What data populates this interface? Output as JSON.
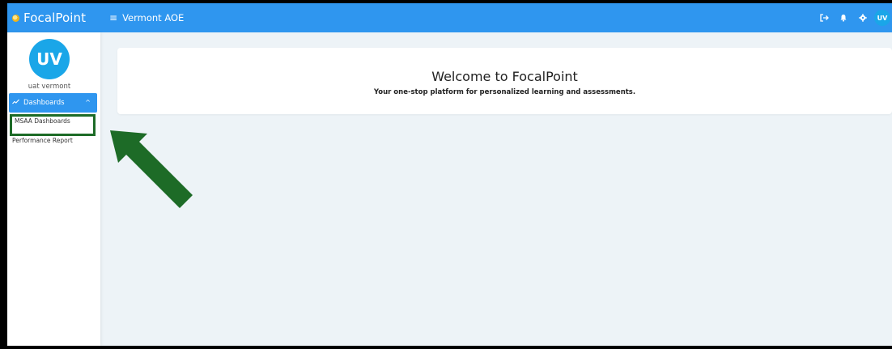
{
  "header": {
    "brand": "FocalPoint",
    "menu_icon": "≡",
    "org": "Vermont AOE",
    "user_initials": "UV",
    "icons": [
      "logout-icon",
      "bell-icon",
      "gear-icon"
    ],
    "color": "#2f96ef"
  },
  "sidebar": {
    "avatar_initials": "UV",
    "username": "uat vermont",
    "section": {
      "label": "Dashboards",
      "icon": "trend-icon",
      "chevron": "^"
    },
    "items": [
      {
        "label": "MSAA Dashboards"
      },
      {
        "label": "Performance Report"
      }
    ]
  },
  "main": {
    "welcome_title": "Welcome to FocalPoint",
    "welcome_subtitle": "Your one-stop platform for personalized learning and assessments."
  },
  "annotation": {
    "arrow_color": "#1d6b27",
    "highlight_color": "#1d6b27"
  }
}
